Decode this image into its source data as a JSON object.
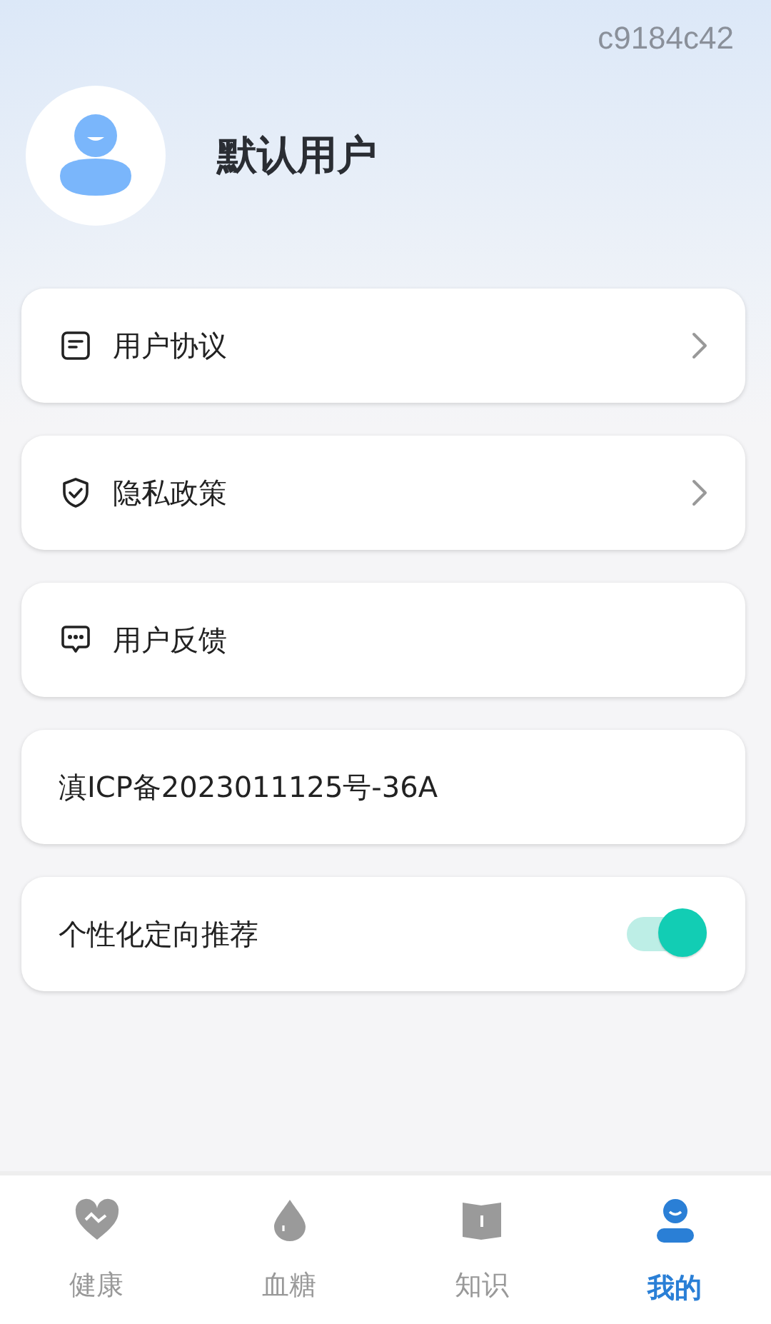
{
  "device_id": "c9184c42",
  "profile": {
    "name": "默认用户"
  },
  "menu": [
    {
      "kind": "link",
      "label": "用户协议"
    },
    {
      "kind": "link",
      "label": "隐私政策"
    },
    {
      "kind": "action",
      "label": "用户反馈"
    },
    {
      "kind": "text",
      "label": "滇ICP备2023011125号-36A"
    },
    {
      "kind": "toggle",
      "label": "个性化定向推荐",
      "on": true
    }
  ],
  "tabs": [
    {
      "label": "健康",
      "selected": false
    },
    {
      "label": "血糖",
      "selected": false
    },
    {
      "label": "知识",
      "selected": false
    },
    {
      "label": "我的",
      "selected": true
    }
  ]
}
